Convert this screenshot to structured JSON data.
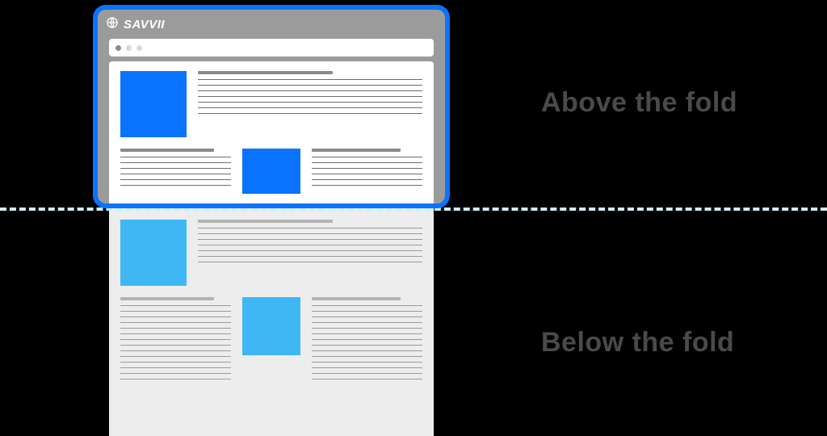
{
  "brand": "SAVVII",
  "labels": {
    "above": "Above the fold",
    "below": "Below the fold"
  },
  "colors": {
    "frame_border": "#0a73ff",
    "frame_bg": "#9b9b9b",
    "above_image": "#0a73ff",
    "below_image": "#3fb7f4",
    "below_page_bg": "#ededed",
    "fold_dash": "#cfeefc",
    "dot_active": "#8c8c8c",
    "dot_inactive": "#d8d8d8",
    "label_text": "#4a4a4a"
  },
  "above_content": {
    "hero_img_w": 82,
    "hero_img_h": 82,
    "mid_img_w": 72,
    "mid_img_h": 56
  },
  "below_content": {
    "hero_img_w": 82,
    "hero_img_h": 82,
    "mid_img_w": 72,
    "mid_img_h": 56
  }
}
